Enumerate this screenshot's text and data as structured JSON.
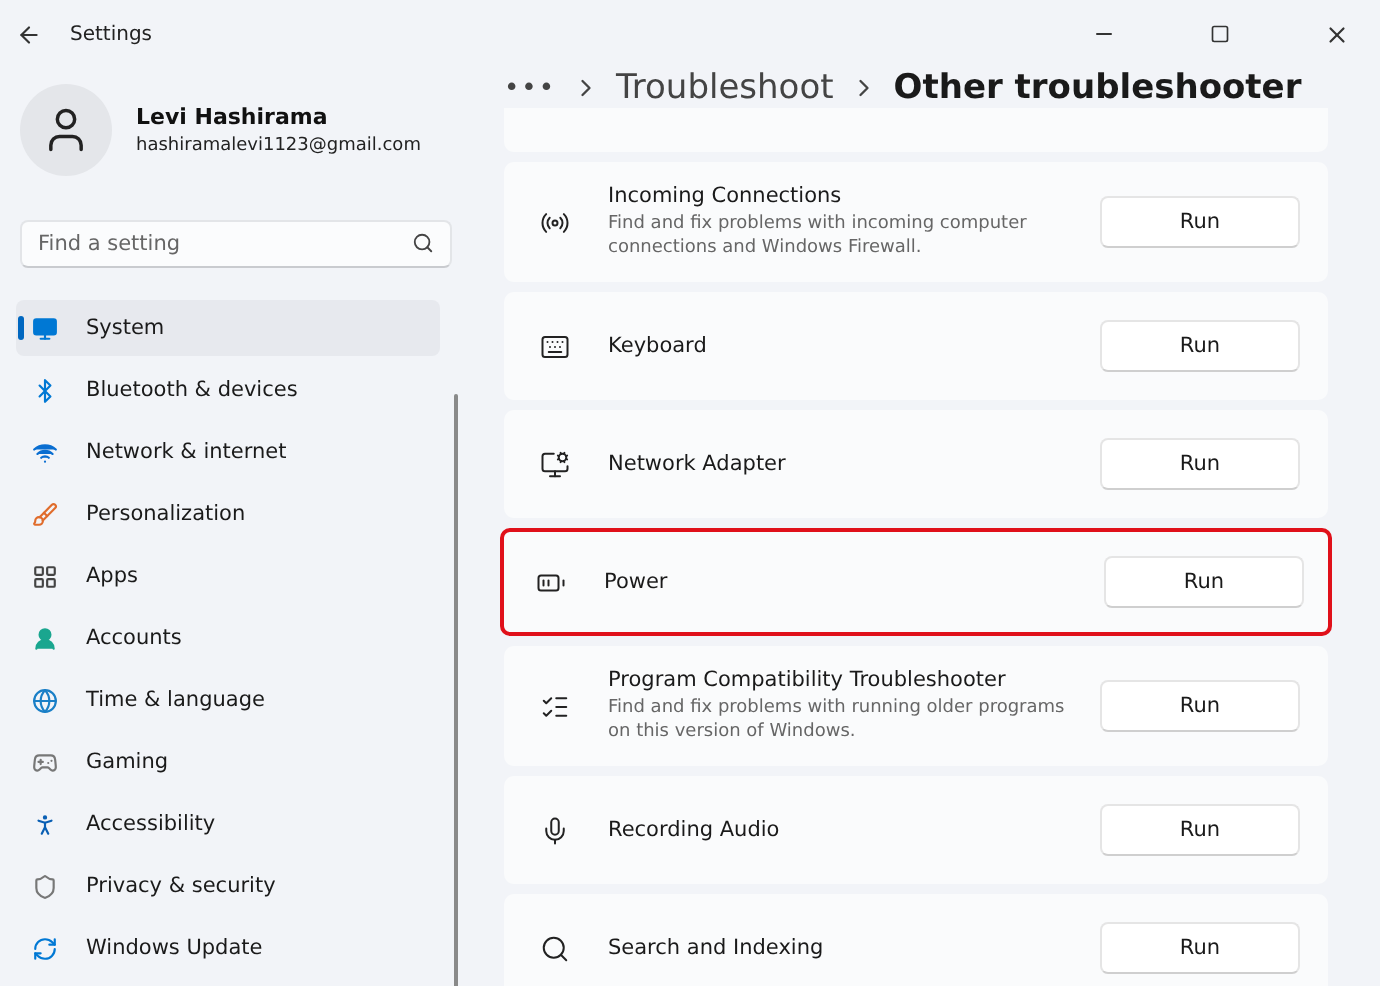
{
  "window": {
    "title": "Settings"
  },
  "profile": {
    "name": "Levi Hashirama",
    "email": "hashiramalevi1123@gmail.com"
  },
  "search": {
    "placeholder": "Find a setting"
  },
  "sidebar": {
    "items": [
      {
        "label": "System",
        "selected": true
      },
      {
        "label": "Bluetooth & devices",
        "selected": false
      },
      {
        "label": "Network & internet",
        "selected": false
      },
      {
        "label": "Personalization",
        "selected": false
      },
      {
        "label": "Apps",
        "selected": false
      },
      {
        "label": "Accounts",
        "selected": false
      },
      {
        "label": "Time & language",
        "selected": false
      },
      {
        "label": "Gaming",
        "selected": false
      },
      {
        "label": "Accessibility",
        "selected": false
      },
      {
        "label": "Privacy & security",
        "selected": false
      },
      {
        "label": "Windows Update",
        "selected": false
      }
    ]
  },
  "breadcrumb": {
    "more": "•••",
    "items": [
      "Troubleshoot",
      "Other troubleshooter"
    ]
  },
  "troubleshooters": [
    {
      "title": "Incoming Connections",
      "description": "Find and fix problems with incoming computer connections and Windows Firewall.",
      "button": "Run",
      "highlighted": false
    },
    {
      "title": "Keyboard",
      "button": "Run",
      "highlighted": false
    },
    {
      "title": "Network Adapter",
      "button": "Run",
      "highlighted": false
    },
    {
      "title": "Power",
      "button": "Run",
      "highlighted": true
    },
    {
      "title": "Program Compatibility Troubleshooter",
      "description": "Find and fix problems with running older programs on this version of Windows.",
      "button": "Run",
      "highlighted": false
    },
    {
      "title": "Recording Audio",
      "button": "Run",
      "highlighted": false
    },
    {
      "title": "Search and Indexing",
      "button": "Run",
      "highlighted": false
    }
  ]
}
